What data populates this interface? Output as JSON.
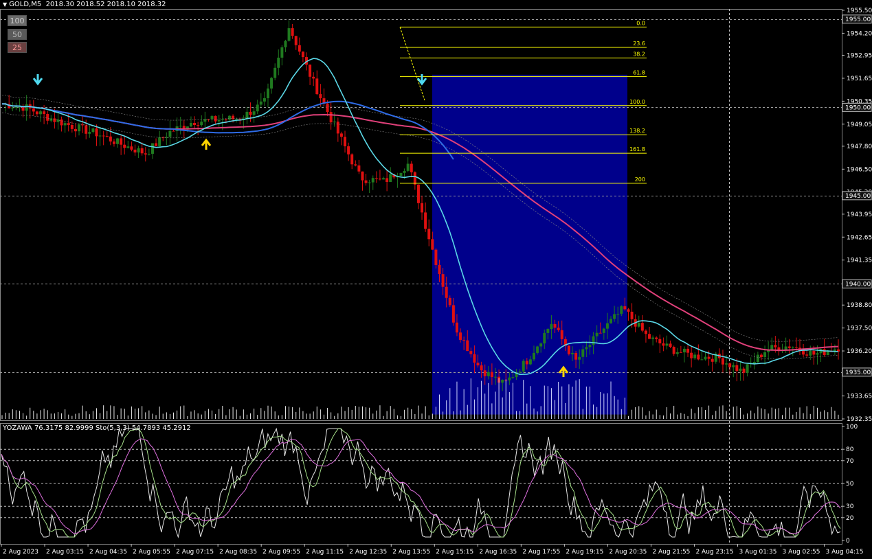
{
  "header": {
    "symbol_tf": "GOLD,M5",
    "ohlc": "2018.30 2018.52 2018.10 2018.32"
  },
  "buttons": [
    "100",
    "50",
    "25"
  ],
  "price_axis": {
    "ticks": [
      "1955.50",
      "1954.20",
      "1952.95",
      "1951.65",
      "1950.35",
      "1949.05",
      "1947.80",
      "1946.50",
      "1945.20",
      "1943.95",
      "1942.65",
      "1941.35",
      "1940.05",
      "1938.80",
      "1937.50",
      "1936.20",
      "1934.90",
      "1933.65",
      "1932.35"
    ],
    "boxed": [
      "1955.00",
      "1950.00",
      "1945.00",
      "1940.00",
      "1935.00"
    ]
  },
  "fibonacci": {
    "levels": [
      "0.0",
      "23.6",
      "38.2",
      "61.8",
      "100.0",
      "138.2",
      "161.8",
      "200"
    ],
    "prices": [
      1954.55,
      1953.4,
      1952.8,
      1951.75,
      1950.1,
      1948.45,
      1947.4,
      1945.7
    ]
  },
  "indicator": {
    "label": "YOZAWA 76.3175 82.9999  Sto(5,3,3) 54.7893 45.2912",
    "axis_labels": [
      "100",
      "80",
      "70",
      "50",
      "30",
      "20",
      "0"
    ]
  },
  "time_axis": {
    "labels": [
      "2 Aug 2023",
      "2 Aug 03:15",
      "2 Aug 04:35",
      "2 Aug 05:55",
      "2 Aug 07:15",
      "2 Aug 08:35",
      "2 Aug 09:55",
      "2 Aug 11:15",
      "2 Aug 12:35",
      "2 Aug 13:55",
      "2 Aug 15:15",
      "2 Aug 16:35",
      "2 Aug 17:55",
      "2 Aug 19:15",
      "2 Aug 20:35",
      "2 Aug 21:55",
      "2 Aug 23:15",
      "3 Aug 01:35",
      "3 Aug 02:55",
      "3 Aug 04:15"
    ]
  },
  "colors": {
    "background": "#000000",
    "bull": "#1f7a1f",
    "bear": "#e01010",
    "fib": "#ffff00",
    "ma_fast": "#5ad7e6",
    "ma_mid": "#2e6be6",
    "ma_slow": "#e0407a",
    "highlight_box": "#00008b",
    "grid": "#808080"
  },
  "chart_data": {
    "type": "line",
    "title": "GOLD,M5",
    "ylim": [
      1932.35,
      1955.5
    ],
    "series": [
      {
        "name": "",
        "values": [
          1950.2,
          1950.0,
          1949.4,
          1948.9,
          1948.5,
          1947.9,
          1947.4,
          1948.6,
          1949.2,
          1949.3,
          1949.4,
          1950.3,
          1954.6,
          1951.5,
          1948.7,
          1946.0,
          1945.8,
          1946.8,
          1942.0,
          1937.5,
          1935.2,
          1934.3,
          1935.7,
          1937.8,
          1935.6,
          1937.2,
          1938.6,
          1937.0,
          1936.3,
          1935.9,
          1935.8,
          1935.0,
          1936.3,
          1936.5,
          1936.0,
          1936.4
        ]
      }
    ]
  }
}
